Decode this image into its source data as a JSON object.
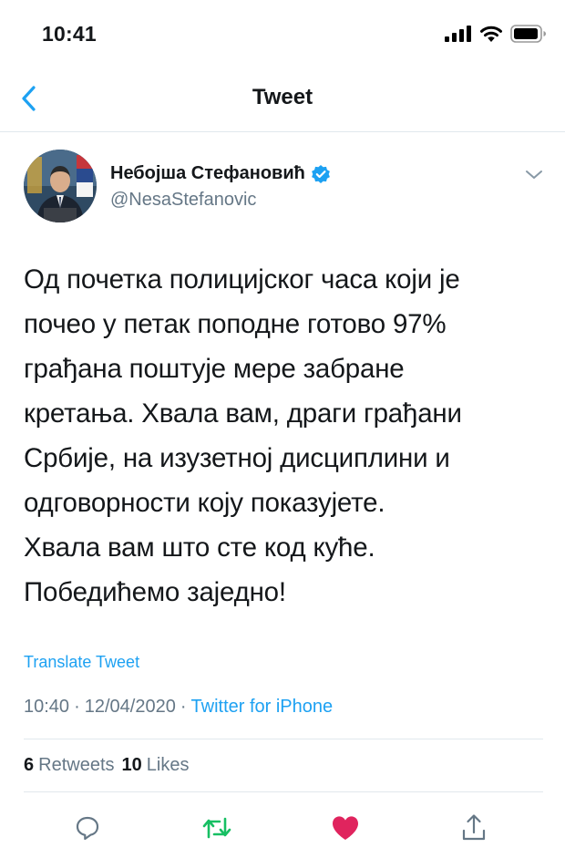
{
  "status_bar": {
    "time": "10:41"
  },
  "nav": {
    "title": "Tweet"
  },
  "author": {
    "name": "Небојша Стефановић",
    "handle": "@NesaStefanovic",
    "verified": true
  },
  "tweet": {
    "text": "Од почетка полицијског часа који је\nпочео у петак поподне готово 97%\nграђана поштује мере забране\nкретања. Хвала вам, драги грађани\nСрбије, на изузетној дисциплини и\nодговорности коју показујете.\nХвала вам што сте код куће.\nПобедићемо заједно!",
    "translate_label": "Translate Tweet",
    "time": "10:40",
    "separator1": "·",
    "date": "12/04/2020",
    "separator2": "·",
    "source": "Twitter for iPhone"
  },
  "stats": {
    "retweets_count": "6",
    "retweets_label": "Retweets",
    "likes_count": "10",
    "likes_label": "Likes"
  },
  "icons": {
    "back": "chevron-left-icon",
    "verified": "verified-badge-icon",
    "caret": "chevron-down-icon",
    "reply": "reply-icon",
    "retweet": "retweet-icon",
    "like": "heart-icon",
    "share": "share-icon"
  },
  "colors": {
    "accent": "#1da1f2",
    "retweet": "#17bf63",
    "like": "#e0245e",
    "secondary_text": "#657786",
    "primary_text": "#14171a"
  }
}
